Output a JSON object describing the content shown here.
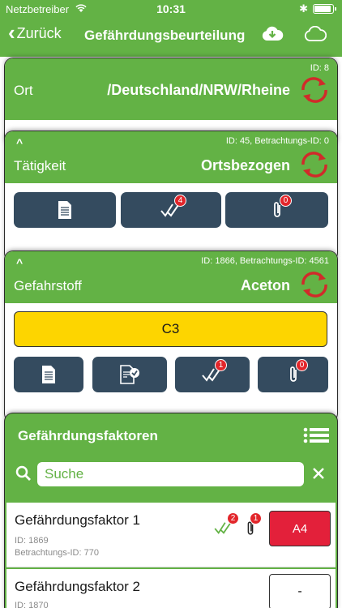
{
  "status": {
    "carrier": "Netzbetreiber",
    "time": "10:31"
  },
  "nav": {
    "back_label": "Zurück",
    "title": "Gefährdungsbeurteilung"
  },
  "ort": {
    "id": "ID:  8",
    "label": "Ort",
    "value": "/Deutschland/NRW/Rheine"
  },
  "taetigkeit": {
    "id": "ID: 45, Betrachtungs-ID: 0",
    "label": "Tätigkeit",
    "value": "Ortsbezogen",
    "badge_check": "4",
    "badge_attach": "0"
  },
  "gefahrstoff": {
    "id": "ID: 1866, Betrachtungs-ID: 4561",
    "label": "Gefahrstoff",
    "value": "Aceton",
    "class_label": "C3",
    "badge_check": "1",
    "badge_attach": "0"
  },
  "faktoren": {
    "title": "Gefährdungsfaktoren",
    "search_placeholder": "Suche",
    "items": [
      {
        "name": "Gefährdungsfaktor 1",
        "id": "ID:  1869",
        "betr": "Betrachtungs-ID:  770",
        "badge_check": "2",
        "badge_attach": "1",
        "rating": "A4"
      },
      {
        "name": "Gefährdungsfaktor 2",
        "id": "ID:  1870",
        "rating": "-"
      }
    ]
  },
  "colors": {
    "accent": "#63b245",
    "button": "#344b5f",
    "badge": "#e2262b",
    "warning": "#fdd500",
    "danger": "#e3203a"
  }
}
